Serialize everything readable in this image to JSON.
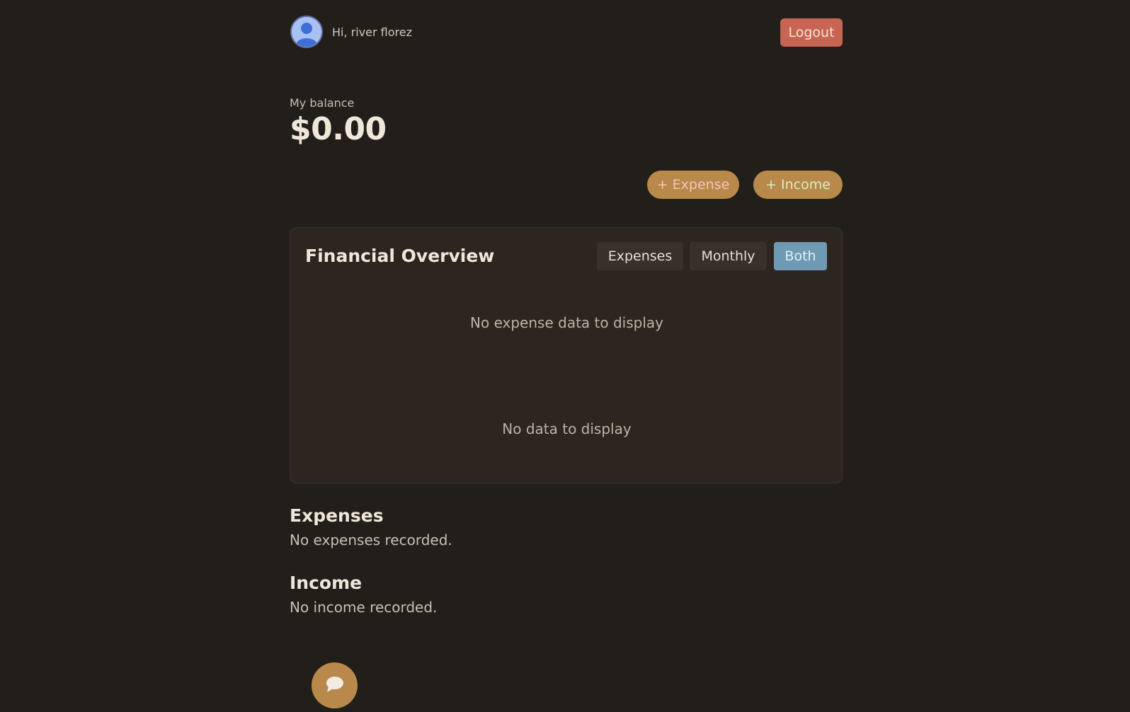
{
  "header": {
    "greeting": "Hi, river florez",
    "logout_label": "Logout"
  },
  "balance": {
    "label": "My balance",
    "value": "$0.00"
  },
  "actions": {
    "add_expense_label": "+ Expense",
    "add_income_label": "+ Income"
  },
  "overview": {
    "title": "Financial Overview",
    "tabs": [
      {
        "label": "Expenses",
        "active": false
      },
      {
        "label": "Monthly",
        "active": false
      },
      {
        "label": "Both",
        "active": true
      }
    ],
    "expense_empty": "No expense data to display",
    "data_empty": "No data to display"
  },
  "expenses": {
    "title": "Expenses",
    "empty": "No expenses recorded."
  },
  "income": {
    "title": "Income",
    "empty": "No income recorded."
  },
  "icons": {
    "avatar": "user-avatar-icon",
    "chat": "chat-bubble-icon"
  },
  "colors": {
    "background": "#221f1b",
    "card": "#2d2620",
    "logout": "#c76452",
    "accent": "#b8894a",
    "active_tab": "#6e9ab4"
  }
}
